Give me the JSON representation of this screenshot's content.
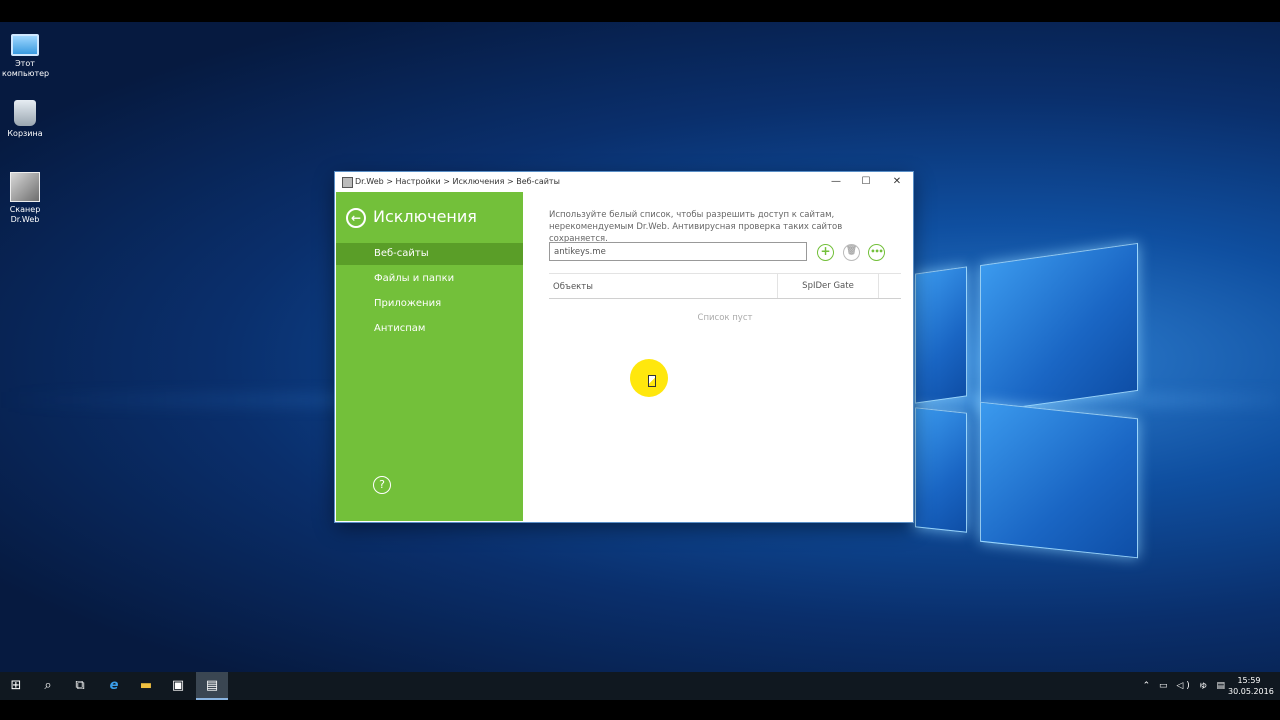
{
  "desktop": {
    "icons": [
      {
        "label_line1": "Этот",
        "label_line2": "компьютер"
      },
      {
        "label_line1": "Корзина",
        "label_line2": ""
      },
      {
        "label_line1": "Сканер",
        "label_line2": "Dr.Web"
      }
    ]
  },
  "window": {
    "breadcrumb": "Dr.Web > Настройки > Исключения > Веб-сайты",
    "controls": {
      "minimize": "—",
      "maximize": "☐",
      "close": "✕"
    }
  },
  "sidebar": {
    "back_icon": "back-arrow-icon",
    "title": "Исключения",
    "items": [
      {
        "label": "Веб-сайты",
        "active": true
      },
      {
        "label": "Файлы и папки",
        "active": false
      },
      {
        "label": "Приложения",
        "active": false
      },
      {
        "label": "Антиспам",
        "active": false
      }
    ],
    "help_label": "?"
  },
  "content": {
    "description": "Используйте белый список, чтобы разрешить доступ к сайтам, нерекомендуемым Dr.Web. Антивирусная проверка таких сайтов сохраняется.",
    "input_value": "antikeys.me",
    "buttons": {
      "add": "+",
      "delete": "🗑",
      "more": "•••"
    },
    "table": {
      "headers": [
        "Объекты",
        "SpIDer Gate"
      ],
      "empty_message": "Список пуст"
    }
  },
  "taskbar": {
    "clock_time": "15:59",
    "clock_date": "30.05.2016",
    "tray_icons": "⌃ ▭ ◁) ゅ ▤"
  },
  "colors": {
    "accent": "#73c03a",
    "accent_active": "#5a9e28",
    "desktop_bg": "#0a2f6c",
    "taskbar": "#101820"
  }
}
